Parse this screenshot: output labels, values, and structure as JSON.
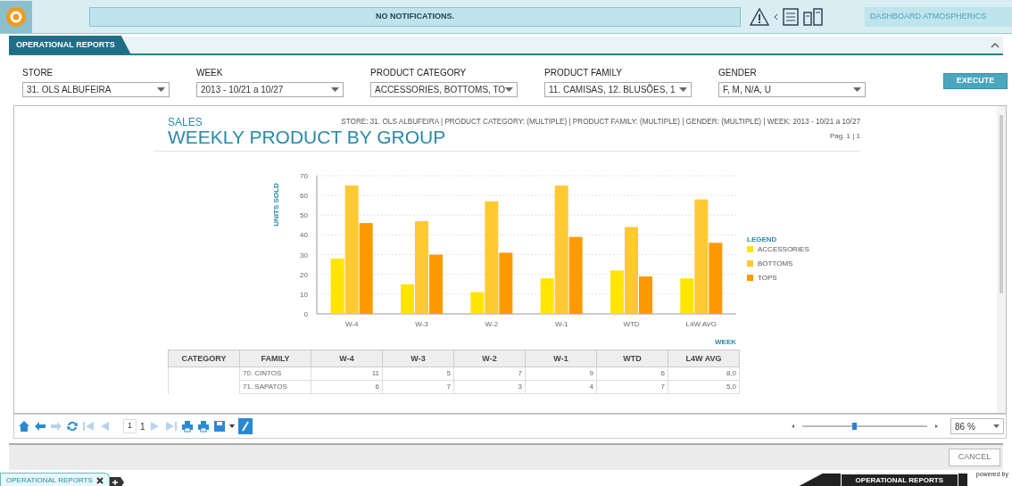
{
  "app_bar": {
    "notification": "NO NOTIFICATIONS.",
    "dashboard": "DASHBOARD ATMOSPHERICS"
  },
  "panel": {
    "title": "OPERATIONAL REPORTS"
  },
  "filters": [
    {
      "label": "STORE",
      "value": "31. OLS ALBUFEIRA"
    },
    {
      "label": "WEEK",
      "value": "2013 - 10/21 a 10/27"
    },
    {
      "label": "PRODUCT CATEGORY",
      "value": "ACCESSORIES, BOTTOMS, TO"
    },
    {
      "label": "PRODUCT FAMILY",
      "value": "11. CAMISAS, 12. BLUSÕES, 1"
    },
    {
      "label": "GENDER",
      "value": "F, M, N/A, U"
    }
  ],
  "execute_button": "EXECUTE",
  "report": {
    "section": "SALES",
    "title": "WEEKLY PRODUCT BY GROUP",
    "criteria": "STORE: 31. OLS ALBUFEIRA | PRODUCT CATEGORY: (MULTIPLE) | PRODUCT FAMILY: (MULTIPLE) | GENDER: (MULTIPLE) | WEEK: 2013 - 10/21 a 10/27",
    "page": "Pag. 1 | 1",
    "legend_title": "LEGEND",
    "chart_data": {
      "type": "bar",
      "xlabel": "WEEK",
      "ylabel": "UNITS SOLD",
      "categories": [
        "W-4",
        "W-3",
        "W-2",
        "W-1",
        "WTD",
        "L4W AVG"
      ],
      "series": [
        {
          "name": "ACCESSORIES",
          "color": "#ffe500",
          "values": [
            28,
            15,
            11,
            18,
            22,
            18
          ]
        },
        {
          "name": "BOTTOMS",
          "color": "#ffc933",
          "values": [
            65,
            47,
            57,
            65,
            44,
            58
          ]
        },
        {
          "name": "TOPS",
          "color": "#ff9900",
          "values": [
            46,
            30,
            31,
            39,
            19,
            36
          ]
        }
      ],
      "grid": true,
      "legend": true,
      "ylim": [
        0,
        70
      ],
      "yticks": [
        0,
        10,
        20,
        30,
        40,
        50,
        60,
        70
      ]
    },
    "table": {
      "columns": [
        "CATEGORY",
        "FAMILY",
        "W-4",
        "W-3",
        "W-2",
        "W-1",
        "WTD",
        "L4W AVG"
      ],
      "rows": [
        {
          "family": "70. CINTOS",
          "values": [
            "11",
            "5",
            "7",
            "9",
            "6",
            "8,0"
          ]
        },
        {
          "family": "71. SAPATOS",
          "values": [
            "6",
            "7",
            "3",
            "4",
            "7",
            "5,0"
          ]
        }
      ]
    }
  },
  "toolbar": {
    "page_current": "1",
    "page_total": "1",
    "zoom_slider": {
      "level": 0.4
    },
    "zoom": "86 %"
  },
  "cancel_button": "CANCEL",
  "tabs": [
    {
      "label": "OPERATIONAL REPORTS",
      "selected": true
    }
  ],
  "footer": {
    "active_module": "OPERATIONAL REPORTS",
    "powered_by": "powered by"
  }
}
